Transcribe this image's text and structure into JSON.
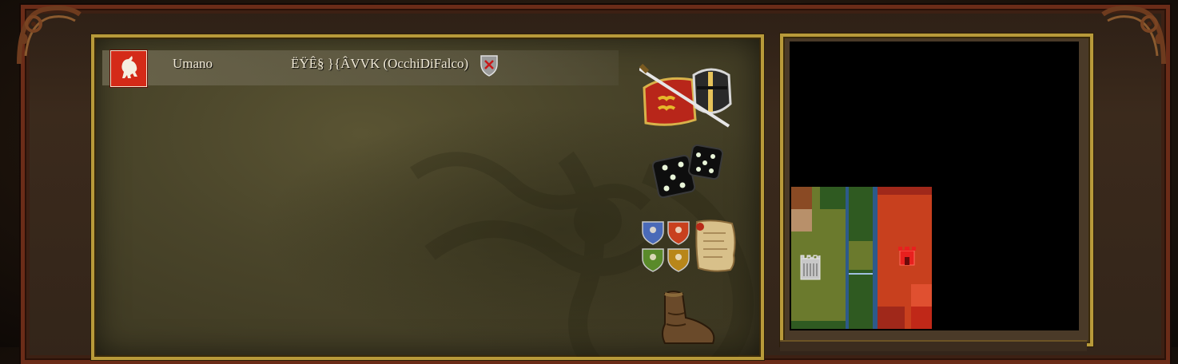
{
  "player": {
    "type_label": "Umano",
    "name": "ËŸÊ§ }{ÂVVK (OcchiDiFalco)",
    "faction_color": "#d42a18",
    "faction_icon": "lion-rampant-icon"
  },
  "side_icons": [
    {
      "name": "knight-helmet-sword-icon"
    },
    {
      "name": "dice-icon"
    },
    {
      "name": "team-shields-scroll-icon"
    },
    {
      "name": "boot-icon"
    }
  ],
  "minimap": {
    "colors": {
      "green_land": "#6b7a2d",
      "dark_green": "#2f5a21",
      "river_blue": "#2d5a8a",
      "red_player": "#c8401e",
      "dark_red": "#a0281a",
      "background": "#000000"
    },
    "markers": [
      {
        "name": "gray-castle-icon",
        "color": "#c8c8c8"
      },
      {
        "name": "red-castle-icon",
        "color": "#e8201e"
      }
    ]
  }
}
